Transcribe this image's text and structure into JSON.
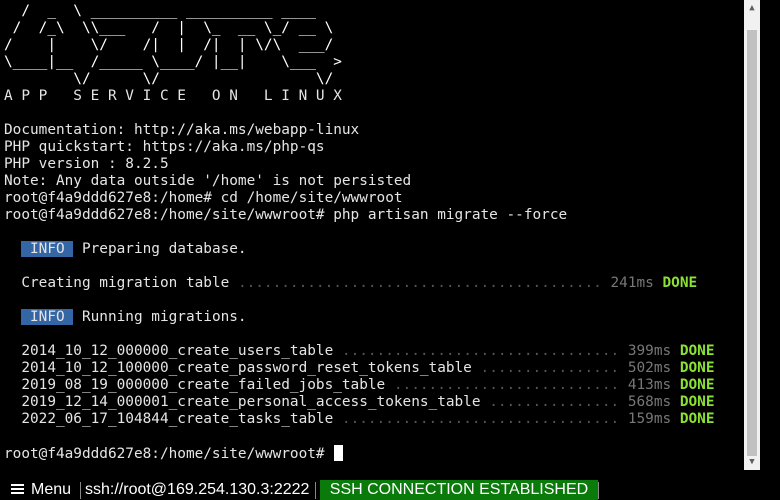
{
  "terminal": {
    "banner_lines": [
      "  /  _  \\ __________ __________ ____",
      " /  /_\\  \\\\___   /  |  \\_  __ \\_/ __ \\",
      "/    |    \\/    /|  |  /|  | \\/\\  ___/",
      "\\____|__  /_____ \\____/ |__|    \\___  >",
      "        \\/      \\/                  \\/"
    ],
    "banner_caption": "A P P   S E R V I C E   O N   L I N U X",
    "info_lines": [
      "Documentation: http://aka.ms/webapp-linux",
      "PHP quickstart: https://aka.ms/php-qs",
      "PHP version : 8.2.5",
      "Note: Any data outside '/home' is not persisted"
    ],
    "commands": [
      "root@f4a9ddd627e8:/home# cd /home/site/wwwroot",
      "root@f4a9ddd627e8:/home/site/wwwroot# php artisan migrate --force"
    ],
    "info_badge": " INFO ",
    "preparing": "Preparing database.",
    "creating_table": {
      "label": "Creating migration table",
      "dots": "..........................................",
      "time": "241ms",
      "status": "DONE"
    },
    "running": "Running migrations.",
    "migrations": [
      {
        "name": "2014_10_12_000000_create_users_table",
        "dots": "................................",
        "time": "399ms",
        "status": "DONE"
      },
      {
        "name": "2014_10_12_100000_create_password_reset_tokens_table",
        "dots": "................",
        "time": "502ms",
        "status": "DONE"
      },
      {
        "name": "2019_08_19_000000_create_failed_jobs_table",
        "dots": "..........................",
        "time": "413ms",
        "status": "DONE"
      },
      {
        "name": "2019_12_14_000001_create_personal_access_tokens_table",
        "dots": "...............",
        "time": "568ms",
        "status": "DONE"
      },
      {
        "name": "2022_06_17_104844_create_tasks_table",
        "dots": "................................",
        "time": "159ms",
        "status": "DONE"
      }
    ],
    "prompt": "root@f4a9ddd627e8:/home/site/wwwroot# "
  },
  "statusbar": {
    "menu_label": "Menu",
    "menu_icon": "hamburger-menu-icon",
    "connection_url": "ssh://root@169.254.130.3:2222",
    "connection_status": "SSH CONNECTION ESTABLISHED",
    "status_color": "#0a7a0a"
  },
  "scrollbar": {
    "up_icon": "scroll-up-arrow-icon",
    "down_icon": "scroll-down-arrow-icon"
  }
}
